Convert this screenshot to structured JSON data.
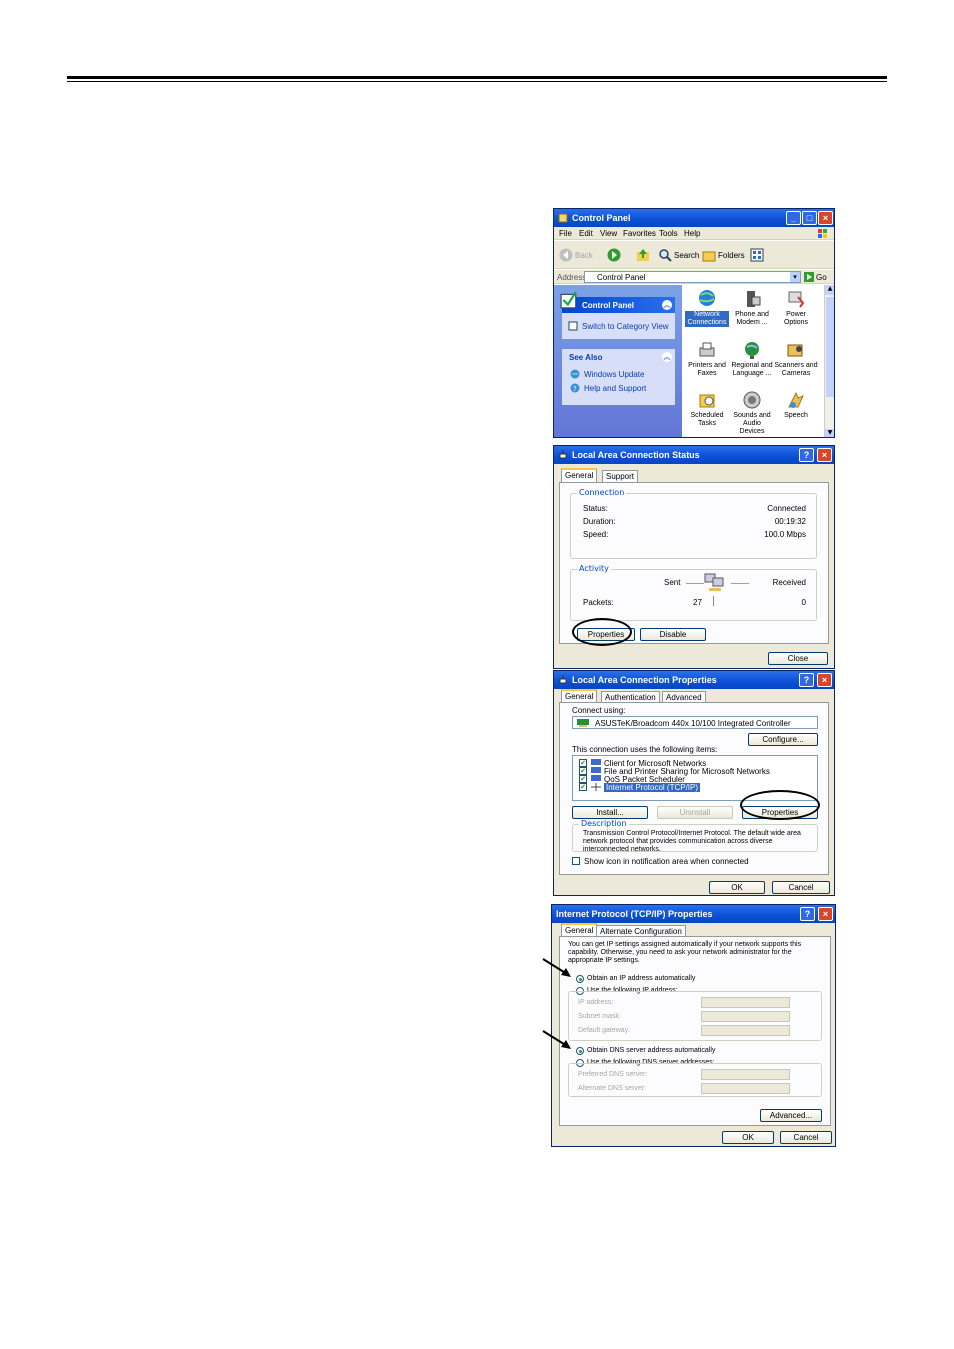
{
  "control_panel": {
    "title": "Control Panel",
    "menu": [
      "File",
      "Edit",
      "View",
      "Favorites",
      "Tools",
      "Help"
    ],
    "toolbar": {
      "back": "Back",
      "search": "Search",
      "folders": "Folders"
    },
    "address_label": "Address",
    "address_value": "Control Panel",
    "go": "Go",
    "sidebar": {
      "panel_title": "Control Panel",
      "switch_view": "Switch to Category View",
      "see_also_title": "See Also",
      "links": [
        "Windows Update",
        "Help and Support"
      ]
    },
    "icons": [
      {
        "label": "Network Connections",
        "icon": "network-globe-icon"
      },
      {
        "label": "Phone and Modem ...",
        "icon": "phone-icon"
      },
      {
        "label": "Power Options",
        "icon": "power-icon"
      },
      {
        "label": "Printers and Faxes",
        "icon": "printer-icon"
      },
      {
        "label": "Regional and Language ...",
        "icon": "globe-icon"
      },
      {
        "label": "Scanners and Cameras",
        "icon": "scanner-icon"
      },
      {
        "label": "Scheduled Tasks",
        "icon": "tasks-folder-icon"
      },
      {
        "label": "Sounds and Audio Devices",
        "icon": "speaker-icon"
      },
      {
        "label": "Speech",
        "icon": "speech-icon"
      }
    ]
  },
  "lan_status": {
    "title": "Local Area Connection Status",
    "tabs": [
      "General",
      "Support"
    ],
    "connection_group": "Connection",
    "status_label": "Status:",
    "status_value": "Connected",
    "duration_label": "Duration:",
    "duration_value": "00:19:32",
    "speed_label": "Speed:",
    "speed_value": "100.0 Mbps",
    "activity_group": "Activity",
    "sent_label": "Sent",
    "received_label": "Received",
    "packets_label": "Packets:",
    "packets_sent": "27",
    "packets_received": "0",
    "properties_button": "Properties",
    "disable_button": "Disable",
    "close_button": "Close"
  },
  "lan_props": {
    "title": "Local Area Connection Properties",
    "tabs": [
      "General",
      "Authentication",
      "Advanced"
    ],
    "connect_using": "Connect using:",
    "adapter": "ASUSTeK/Broadcom 440x 10/100 Integrated Controller",
    "configure_button": "Configure...",
    "items_label": "This connection uses the following items:",
    "items": [
      "Client for Microsoft Networks",
      "File and Printer Sharing for Microsoft Networks",
      "QoS Packet Scheduler",
      "Internet Protocol (TCP/IP)"
    ],
    "install_button": "Install...",
    "uninstall_button": "Uninstall",
    "properties_button": "Properties",
    "description_group": "Description",
    "description_text": "Transmission Control Protocol/Internet Protocol. The default wide area network protocol that provides communication across diverse interconnected networks.",
    "show_icon": "Show icon in notification area when connected",
    "ok_button": "OK",
    "cancel_button": "Cancel"
  },
  "tcpip": {
    "title": "Internet Protocol (TCP/IP) Properties",
    "tabs": [
      "General",
      "Alternate Configuration"
    ],
    "intro": "You can get IP settings assigned automatically if your network supports this capability. Otherwise, you need to ask your network administrator for the appropriate IP settings.",
    "obtain_ip": "Obtain an IP address automatically",
    "use_ip": "Use the following IP address:",
    "ip_address": "IP address:",
    "subnet_mask": "Subnet mask:",
    "default_gateway": "Default gateway:",
    "obtain_dns": "Obtain DNS server address automatically",
    "use_dns": "Use the following DNS server addresses:",
    "preferred_dns": "Preferred DNS server:",
    "alternate_dns": "Alternate DNS server:",
    "advanced_button": "Advanced...",
    "ok_button": "OK",
    "cancel_button": "Cancel"
  }
}
